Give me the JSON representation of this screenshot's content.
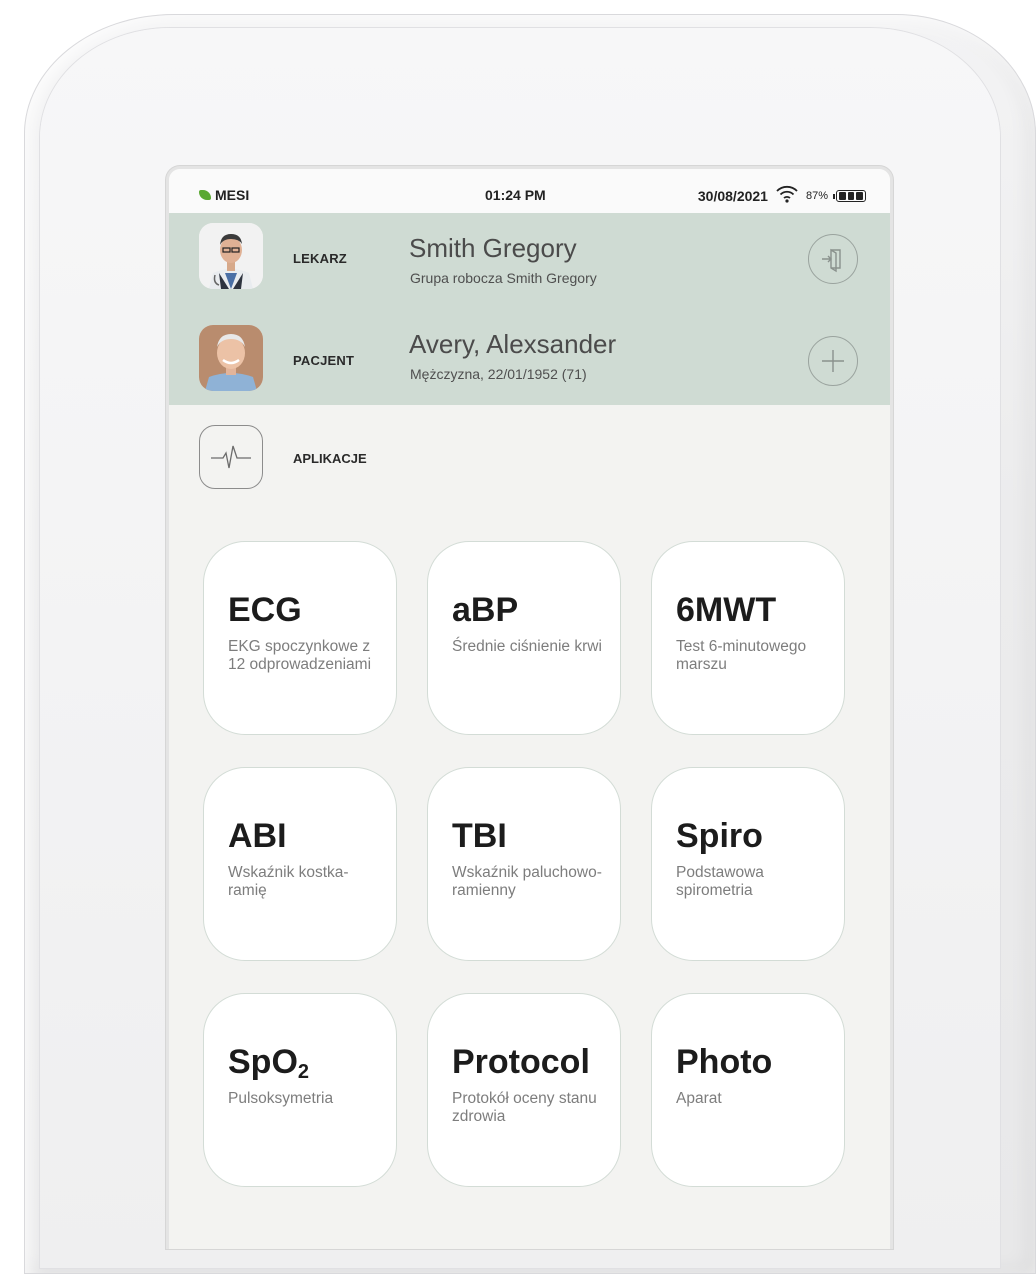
{
  "status_bar": {
    "brand": "MESI",
    "time": "01:24 PM",
    "date": "30/08/2021",
    "battery_percent": "87%",
    "battery_level": 0.87,
    "icons": [
      "leaf-icon",
      "wifi-icon",
      "battery-icon"
    ]
  },
  "doctor": {
    "role": "LEKARZ",
    "name": "Smith Gregory",
    "subtitle": "Grupa robocza Smith Gregory",
    "action_icon": "logout-icon"
  },
  "patient": {
    "role": "PACJENT",
    "name": "Avery, Alexsander",
    "subtitle": "Mężczyzna, 22/01/1952 (71)",
    "action_icon": "plus-icon"
  },
  "apps_section": {
    "label": "APLIKACJE",
    "icon": "heartbeat-icon"
  },
  "apps": [
    {
      "id": "ecg",
      "title": "ECG",
      "desc": "EKG spoczynkowe z 12 odprowadzeniami"
    },
    {
      "id": "abp",
      "title": "aBP",
      "desc": "Średnie ciśnienie krwi"
    },
    {
      "id": "6mwt",
      "title": "6MWT",
      "desc": "Test 6-minutowego marszu"
    },
    {
      "id": "abi",
      "title": "ABI",
      "desc": "Wskaźnik kostka-ramię"
    },
    {
      "id": "tbi",
      "title": "TBI",
      "desc": "Wskaźnik paluchowo-ramienny"
    },
    {
      "id": "spiro",
      "title": "Spiro",
      "desc": "Podstawowa spirometria"
    },
    {
      "id": "spo2",
      "title_main": "SpO",
      "title_sub": "2",
      "desc": "Pulsoksymetria"
    },
    {
      "id": "protocol",
      "title": "Protocol",
      "desc": "Protokół oceny stanu zdrowia"
    },
    {
      "id": "photo",
      "title": "Photo",
      "desc": "Aparat"
    }
  ],
  "colors": {
    "header_row": "#cfdbd3",
    "screen_bg": "#f3f3f1",
    "brand_green": "#5aa832"
  }
}
